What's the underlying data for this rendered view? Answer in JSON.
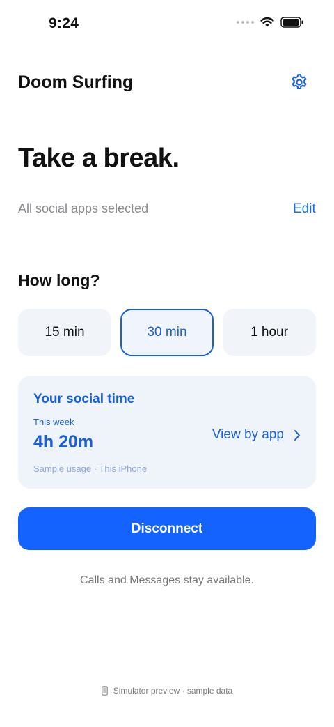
{
  "status_bar": {
    "time": "9:24"
  },
  "header": {
    "title": "Doom Surfing",
    "settings_icon": "gear-icon"
  },
  "headline": "Take a break.",
  "selection": {
    "summary": "All social apps selected",
    "edit_label": "Edit"
  },
  "duration": {
    "heading": "How long?",
    "options": [
      "15 min",
      "30 min",
      "1 hour"
    ],
    "selected": "30 min"
  },
  "usage_card": {
    "title": "Your social time",
    "period": "This week",
    "value": "4h 20m",
    "view_label": "View by app",
    "note": "Sample usage · This iPhone"
  },
  "primary_action": "Disconnect",
  "footnote": "Calls and Messages stay available.",
  "preview_note": "Simulator preview · sample data",
  "colors": {
    "accent": "#1a5fd4",
    "button": "#1463ff",
    "card": "#eff4fb",
    "chip": "#f1f4f9"
  }
}
